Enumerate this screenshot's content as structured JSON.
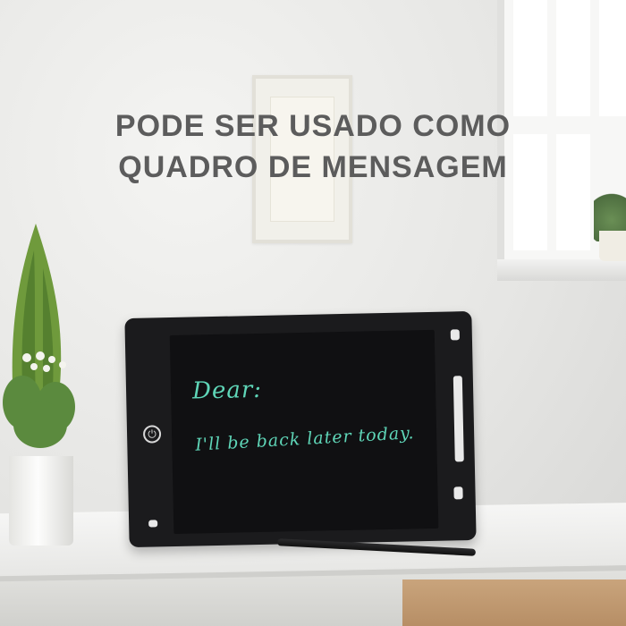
{
  "headline": {
    "line1": "PODE SER USADO COMO",
    "line2": "QUADRO DE MENSAGEM"
  },
  "tablet_screen": {
    "line1": "Dear:",
    "line2": "I'll be back later today."
  },
  "colors": {
    "headline": "#5c5c5c",
    "screen_ink": "#5fd6b8",
    "tablet_body": "#1b1b1d"
  },
  "icons": [
    "power-icon"
  ]
}
